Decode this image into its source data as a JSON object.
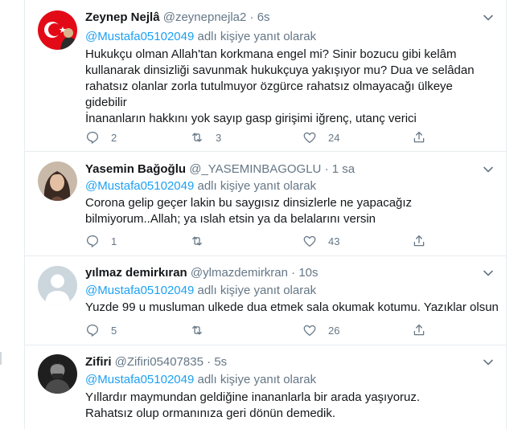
{
  "reply_label": "adlı kişiye yanıt olarak",
  "tweets": [
    {
      "name": "Zeynep Nejlâ",
      "handle": "@zeynepnejla2",
      "time": "6s",
      "mention": "@Mustafa05102049",
      "lines": [
        "Hukukçu olman Allah'tan korkmana engel mi? Sinir bozucu gibi kelâm",
        "kullanarak dinsizliği savunmak hukukçuya yakışıyor mu? Dua ve selâdan",
        "rahatsız olanlar zorla tutulmuyor özgürce rahatsız olmayacağı ülkeye",
        "gidebilir",
        "İnananların hakkını yok sayıp gasp girişimi iğrenç, utanç verici"
      ],
      "replies": "2",
      "retweets": "3",
      "likes": "24"
    },
    {
      "name": "Yasemin Bağoğlu",
      "handle": "@_YASEMINBAGOGLU",
      "time": "1 sa",
      "mention": "@Mustafa05102049",
      "lines": [
        "Corona gelip geçer lakin bu saygısız dinsizlerle ne yapacağız",
        "bilmiyorum..Allah; ya ıslah etsin ya da belalarını versin"
      ],
      "replies": "1",
      "retweets": "",
      "likes": "43"
    },
    {
      "name": "yılmaz demirkıran",
      "handle": "@ylmazdemirkran",
      "time": "10s",
      "mention": "@Mustafa05102049",
      "lines": [
        "Yuzde 99 u musluman ulkede dua etmek sala okumak kotumu. Yazıklar olsun"
      ],
      "replies": "5",
      "retweets": "",
      "likes": "26"
    },
    {
      "name": "Zifiri",
      "handle": "@Zifiri05407835",
      "time": "5s",
      "mention": "@Mustafa05102049",
      "lines": [
        "Yıllardır  maymundan geldiğine inananlarla bir arada yaşıyoruz.",
        "Rahatsız olup ormanınıza geri dönün demedik."
      ]
    }
  ],
  "colors": {
    "accent": "#1da1f2",
    "muted": "#657786",
    "text": "#14171a",
    "border": "#e6ecf0"
  },
  "icons": [
    "chevron-down-icon",
    "reply-icon",
    "retweet-icon",
    "like-icon",
    "share-icon"
  ]
}
